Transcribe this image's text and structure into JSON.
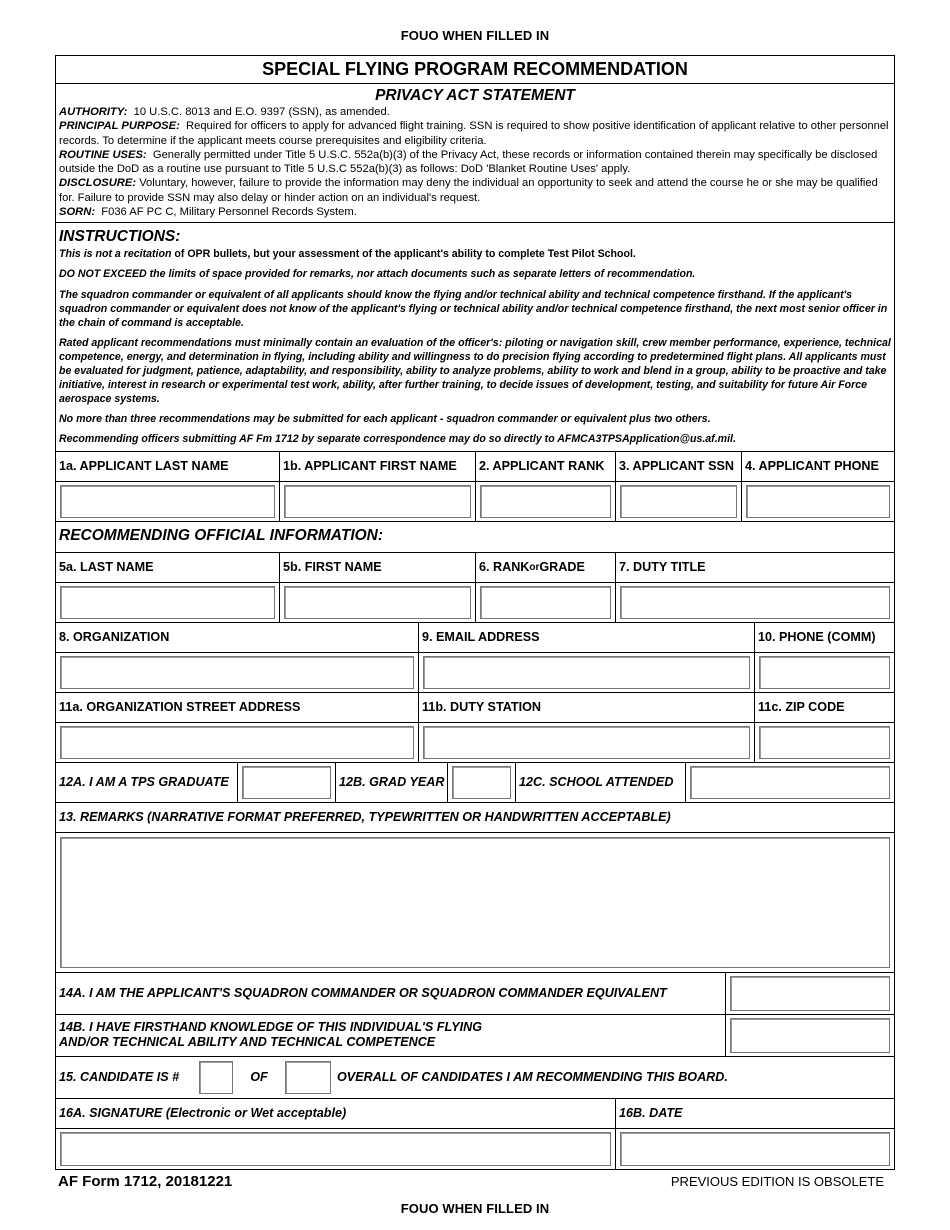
{
  "header": {
    "classification_top": "FOUO WHEN FILLED IN",
    "classification_bottom": "FOUO WHEN FILLED IN",
    "title": "SPECIAL FLYING PROGRAM RECOMMENDATION"
  },
  "privacy": {
    "title": "PRIVACY ACT STATEMENT",
    "authority_label": "AUTHORITY:",
    "authority_text": "10 U.S.C. 8013 and E.O. 9397 (SSN), as amended.",
    "purpose_label": "PRINCIPAL PURPOSE:",
    "purpose_text": "Required for officers to apply for advanced flight training. SSN is required to show positive identification of applicant relative to other personnel records. To determine if the applicant meets course prerequisites and eligibility criteria.",
    "routine_label": "ROUTINE USES:",
    "routine_text": "Generally permitted under Title 5 U.S.C. 552a(b)(3) of the Privacy Act, these records or information contained therein may specifically be disclosed outside the DoD as a routine use pursuant to Title 5 U.S.C 552a(b)(3) as follows: DoD 'Blanket Routine Uses' apply.",
    "disclosure_label": "DISCLOSURE:",
    "disclosure_text": "Voluntary, however, failure to provide the information may deny the individual an opportunity to seek and attend the course he or she may be qualified for. Failure to provide SSN may also delay or hinder action on an individual's request.",
    "sorn_label": "SORN:",
    "sorn_text": "F036 AF PC C, Military Personnel Records System."
  },
  "instructions": {
    "title": "INSTRUCTIONS:",
    "p1_a": "This is not a recitation ",
    "p1_b": "of OPR bullets, but your assessment of the applicant's ability to complete Test Pilot School.",
    "p2": "DO NOT EXCEED the limits of space provided for remarks, nor attach documents such as separate letters of recommendation.",
    "p3": "The squadron commander or equivalent of all applicants should know the flying and/or technical ability and technical competence firsthand. If the applicant's squadron commander or equivalent does not know of the applicant's flying or technical ability and/or technical competence firsthand, the next most senior officer in the chain of command is acceptable.",
    "p4": "Rated applicant recommendations must minimally contain an evaluation of the officer's: piloting or navigation skill, crew member performance, experience, technical competence, energy, and determination in flying, including ability and willingness to do precision flying according to predetermined flight plans.  All applicants must be evaluated for judgment, patience, adaptability, and responsibility, ability to analyze problems, ability to work and blend in a group, ability to be proactive and take initiative, interest in research or experimental test work, ability, after further training, to decide issues of development, testing, and suitability for future Air Force aerospace systems.",
    "p5": "No more than three recommendations may be submitted for each applicant - squadron commander or equivalent plus two others.",
    "p6": "Recommending officers submitting AF Fm 1712 by separate correspondence may do so directly to AFMCA3TPSApplication@us.af.mil."
  },
  "applicant": {
    "last_name_label": "1a. APPLICANT LAST NAME",
    "first_name_label": "1b. APPLICANT FIRST NAME",
    "rank_label": "2. APPLICANT RANK",
    "ssn_label": "3. APPLICANT SSN",
    "phone_label": "4. APPLICANT PHONE",
    "last_name_value": "",
    "first_name_value": "",
    "rank_value": "",
    "ssn_value": "",
    "phone_value": ""
  },
  "official": {
    "section_title": "RECOMMENDING OFFICIAL INFORMATION:",
    "last_name_label": "5a. LAST NAME",
    "first_name_label": "5b. FIRST NAME",
    "rank_label_a": "6. RANK ",
    "rank_label_or": "or",
    "rank_label_b": " GRADE",
    "duty_title_label": "7. DUTY TITLE",
    "organization_label": "8. ORGANIZATION",
    "email_label": "9. EMAIL ADDRESS",
    "phone_label": "10. PHONE (COMM)",
    "street_label": "11a.  ORGANIZATION STREET ADDRESS",
    "duty_station_label": "11b.  DUTY STATION",
    "zip_label": "11c. ZIP CODE"
  },
  "tps": {
    "graduate_label": "12A. I AM A TPS GRADUATE",
    "grad_year_label": "12B. GRAD YEAR",
    "school_label": "12C. SCHOOL ATTENDED"
  },
  "remarks": {
    "label": "13. REMARKS (NARRATIVE FORMAT PREFERRED, TYPEWRITTEN OR HANDWRITTEN ACCEPTABLE)",
    "value": ""
  },
  "certification": {
    "commander_label": "14A. I AM THE APPLICANT'S SQUADRON COMMANDER OR SQUADRON COMMANDER EQUIVALENT",
    "knowledge_label_1": "14B. I HAVE FIRSTHAND KNOWLEDGE OF THIS INDIVIDUAL'S FLYING",
    "knowledge_label_2": "AND/OR TECHNICAL ABILITY AND TECHNICAL COMPETENCE"
  },
  "ranking": {
    "label_a": "15. CANDIDATE IS #",
    "label_of": "OF",
    "label_b": "OVERALL OF CANDIDATES I AM RECOMMENDING THIS BOARD."
  },
  "signature": {
    "signature_label": "16A. SIGNATURE (Electronic or Wet acceptable)",
    "date_label": "16B. DATE"
  },
  "footer": {
    "form_id": "AF Form 1712, 20181221",
    "edition_note": "PREVIOUS EDITION IS OBSOLETE"
  }
}
